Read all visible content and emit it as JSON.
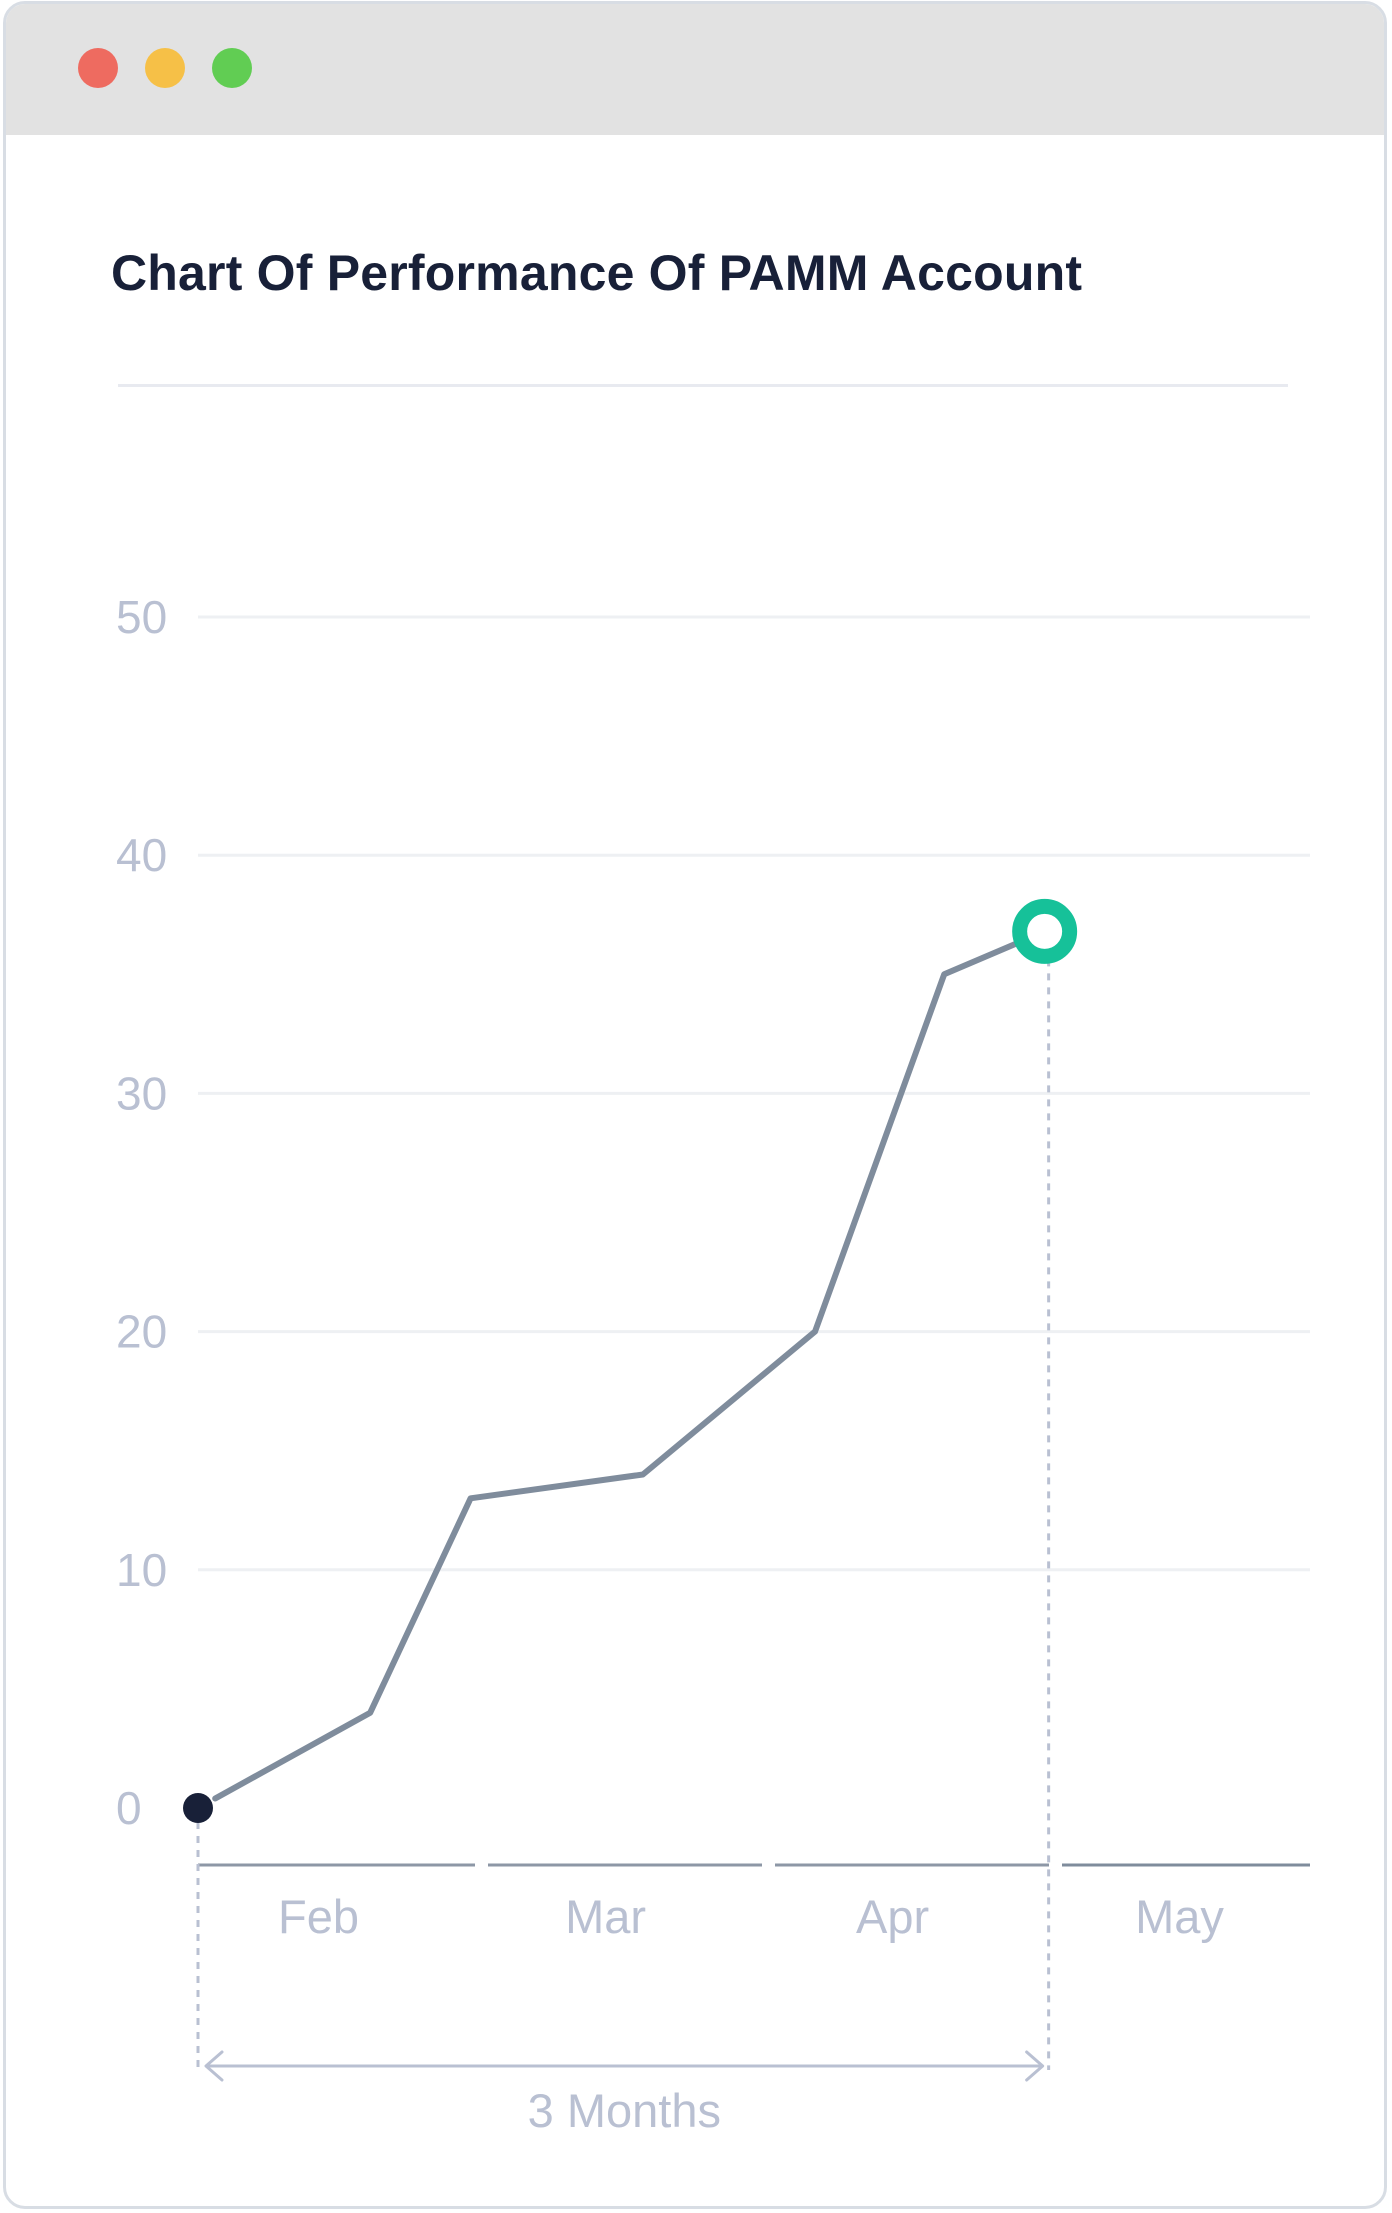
{
  "window": {
    "controls": [
      "close-dot",
      "minimize-dot",
      "maximize-dot"
    ],
    "colors": {
      "close": "#ee6b60",
      "minimize": "#f6c047",
      "maximize": "#61cd53"
    }
  },
  "chart_data": {
    "type": "line",
    "title": "Chart Of Performance Of PAMM Account",
    "xlabel": "",
    "ylabel": "",
    "categories": [
      "Feb",
      "Mar",
      "Apr",
      "May"
    ],
    "x": [
      0.0,
      0.6,
      0.95,
      1.55,
      2.15,
      2.6,
      2.95
    ],
    "y": [
      0,
      4,
      13,
      14,
      20,
      35,
      36.8
    ],
    "yticks": [
      0,
      10,
      20,
      30,
      40,
      50
    ],
    "ylim": [
      0,
      50
    ],
    "xlim": [
      0,
      4
    ],
    "grid": true,
    "line_color": "#7f8c9c",
    "start_marker_color": "#182038",
    "end_marker_color": "#16c199",
    "annotation": {
      "label": "3 Months",
      "from_x": 0,
      "to_x": 2.95
    }
  }
}
